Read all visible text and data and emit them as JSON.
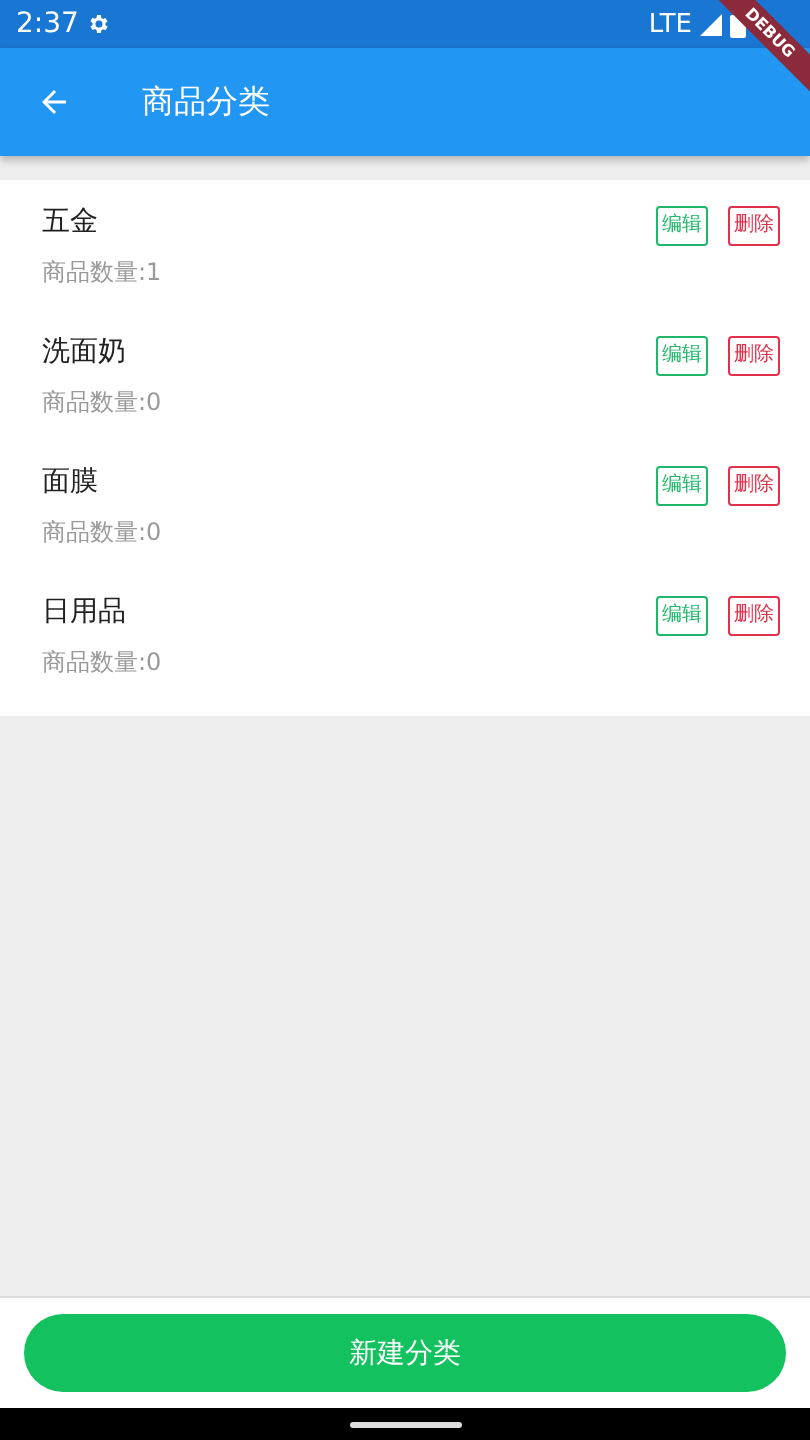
{
  "status_bar": {
    "time": "2:37",
    "network": "LTE"
  },
  "debug_banner": "DEBUG",
  "app_bar": {
    "title": "商品分类"
  },
  "categories": [
    {
      "name": "五金",
      "count": "商品数量:1",
      "edit": "编辑",
      "delete": "删除"
    },
    {
      "name": "洗面奶",
      "count": "商品数量:0",
      "edit": "编辑",
      "delete": "删除"
    },
    {
      "name": "面膜",
      "count": "商品数量:0",
      "edit": "编辑",
      "delete": "删除"
    },
    {
      "name": "日用品",
      "count": "商品数量:0",
      "edit": "编辑",
      "delete": "删除"
    }
  ],
  "new_button": "新建分类"
}
